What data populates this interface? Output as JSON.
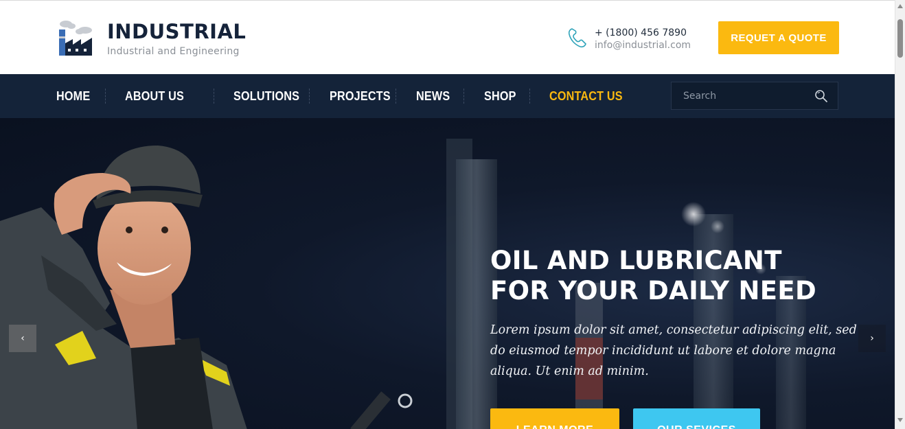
{
  "brand": {
    "name": "INDUSTRIAL",
    "tagline": "Industrial and Engineering",
    "logo_icon": "factory-icon"
  },
  "contact": {
    "phone": "+ (1800) 456 7890",
    "email": "info@industrial.com",
    "icon": "phone-icon"
  },
  "header": {
    "quote_label": "REQUET A QUOTE"
  },
  "nav": {
    "items": [
      {
        "label": "HOME",
        "active": false
      },
      {
        "label": "ABOUT US",
        "active": false
      },
      {
        "label": "SOLUTIONS",
        "active": false
      },
      {
        "label": "PROJECTS",
        "active": false
      },
      {
        "label": "NEWS",
        "active": false
      },
      {
        "label": "SHOP",
        "active": false
      },
      {
        "label": "CONTACT US",
        "active": true
      }
    ],
    "search_placeholder": "Search"
  },
  "hero": {
    "title_line1": "OIL AND LUBRICANT",
    "title_line2": "FOR YOUR DAILY NEED",
    "text": "Lorem ipsum dolor sit amet, consectetur adipiscing elit, sed do eiusmod tempor incididunt ut labore et dolore magna aliqua. Ut enim ad minim.",
    "learn_more_label": "LEARN MORE",
    "services_label": "OUR SEVICES",
    "prev_icon": "‹",
    "next_icon": "›"
  },
  "colors": {
    "accent": "#fbb910",
    "nav_bg": "#142339",
    "secondary": "#3ec7f0",
    "brand_text": "#15233a"
  }
}
